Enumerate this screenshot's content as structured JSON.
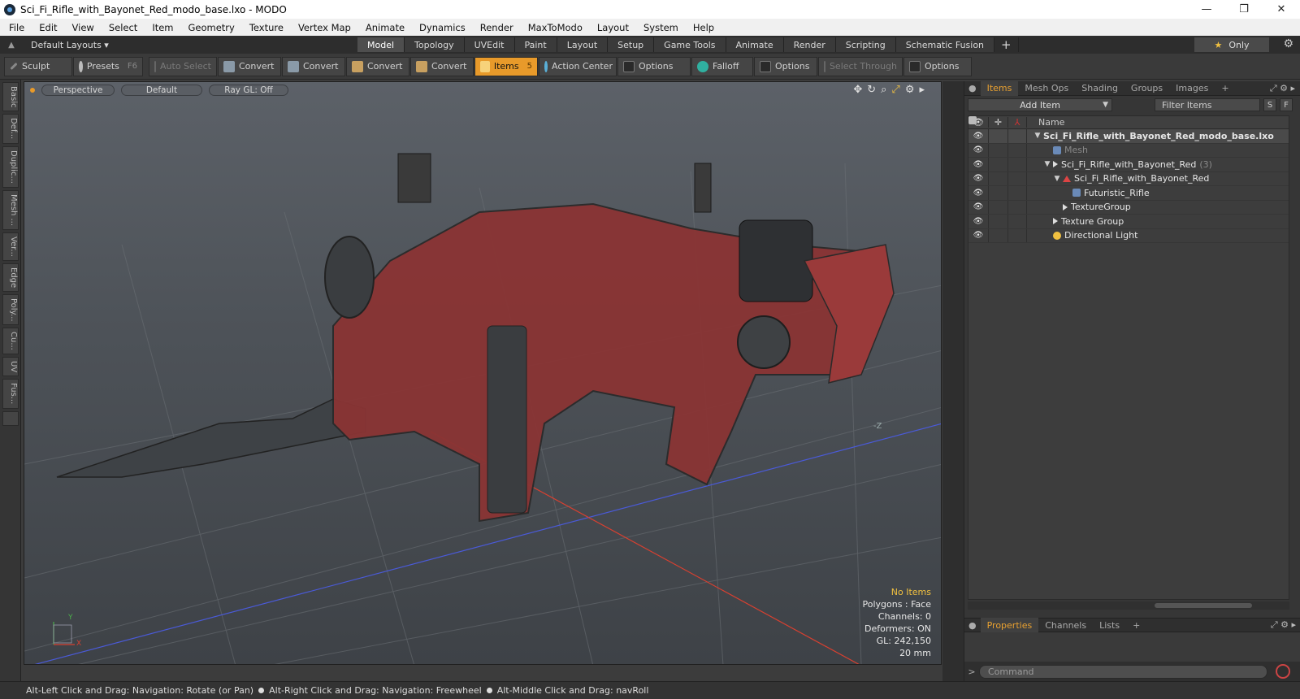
{
  "window": {
    "title": "Sci_Fi_Rifle_with_Bayonet_Red_modo_base.lxo - MODO",
    "controls": [
      "—",
      "❐",
      "✕"
    ]
  },
  "menu": [
    "File",
    "Edit",
    "View",
    "Select",
    "Item",
    "Geometry",
    "Texture",
    "Vertex Map",
    "Animate",
    "Dynamics",
    "Render",
    "MaxToModo",
    "Layout",
    "System",
    "Help"
  ],
  "modebar": {
    "layouts_label": "Default Layouts ▾",
    "tabs": [
      "Model",
      "Topology",
      "UVEdit",
      "Paint",
      "Layout",
      "Setup",
      "Game Tools",
      "Animate",
      "Render",
      "Scripting",
      "Schematic Fusion"
    ],
    "active_tab": "Model",
    "add": "+",
    "only_label": "Only"
  },
  "toolbar": {
    "sculpt": "Sculpt",
    "presets": "Presets",
    "presets_key": "F6",
    "auto_select": "Auto Select",
    "convert1": "Convert",
    "convert2": "Convert",
    "convert3": "Convert",
    "convert4": "Convert",
    "items": "Items",
    "items_key": "5",
    "action_center": "Action Center",
    "options1": "Options",
    "falloff": "Falloff",
    "options2": "Options",
    "select_through": "Select Through",
    "options3": "Options"
  },
  "left_tabs": [
    "Basic",
    "Def...",
    "Duplic...",
    "Mesh ...",
    "Ver...",
    "Edge",
    "Poly...",
    "Cu...",
    "UV",
    "Fus..."
  ],
  "viewport": {
    "view": "Perspective",
    "shading": "Default",
    "raygl": "Ray GL: Off",
    "info": {
      "items": "No Items",
      "polygons": "Polygons : Face",
      "channels": "Channels: 0",
      "deformers": "Deformers: ON",
      "gl": "GL: 242,150",
      "scale": "20 mm"
    },
    "axis": {
      "y": "Y",
      "x": "X",
      "z": "-Z"
    }
  },
  "items_panel": {
    "tabs": [
      "Items",
      "Mesh Ops",
      "Shading",
      "Groups",
      "Images"
    ],
    "active_tab": "Items",
    "add_item": "Add Item",
    "filter": "Filter Items",
    "s_btn": "S",
    "f_btn": "F",
    "name_col": "Name",
    "rows": [
      {
        "label": "Sci_Fi_Rifle_with_Bayonet_Red_modo_base.lxo",
        "indent": 0,
        "twisty": "▼",
        "icon": "scene",
        "bold": true
      },
      {
        "label": "Mesh",
        "indent": 1,
        "twisty": "",
        "icon": "mesh",
        "dim": true
      },
      {
        "label": "Sci_Fi_Rifle_with_Bayonet_Red",
        "indent": 1,
        "twisty": "▼",
        "icon": "group",
        "count": "(3)"
      },
      {
        "label": "Sci_Fi_Rifle_with_Bayonet_Red",
        "indent": 2,
        "twisty": "▼",
        "icon": "locator"
      },
      {
        "label": "Futuristic_Rifle",
        "indent": 3,
        "twisty": "",
        "icon": "mesh"
      },
      {
        "label": "TextureGroup",
        "indent": 2,
        "twisty": "",
        "icon": "group"
      },
      {
        "label": "Texture Group",
        "indent": 1,
        "twisty": "",
        "icon": "group"
      },
      {
        "label": "Directional Light",
        "indent": 1,
        "twisty": "",
        "icon": "light"
      }
    ]
  },
  "props_panel": {
    "tabs": [
      "Properties",
      "Channels",
      "Lists"
    ],
    "active_tab": "Properties"
  },
  "command": {
    "placeholder": "Command"
  },
  "status": {
    "hint1": "Alt-Left Click and Drag: Navigation: Rotate (or Pan)",
    "hint2": "Alt-Right Click and Drag: Navigation: Freewheel",
    "hint3": "Alt-Middle Click and Drag: navRoll"
  },
  "colors": {
    "accent": "#e89a2a",
    "x_axis": "#e04030",
    "z_axis": "#4060d0",
    "model_red": "#9a3030"
  }
}
